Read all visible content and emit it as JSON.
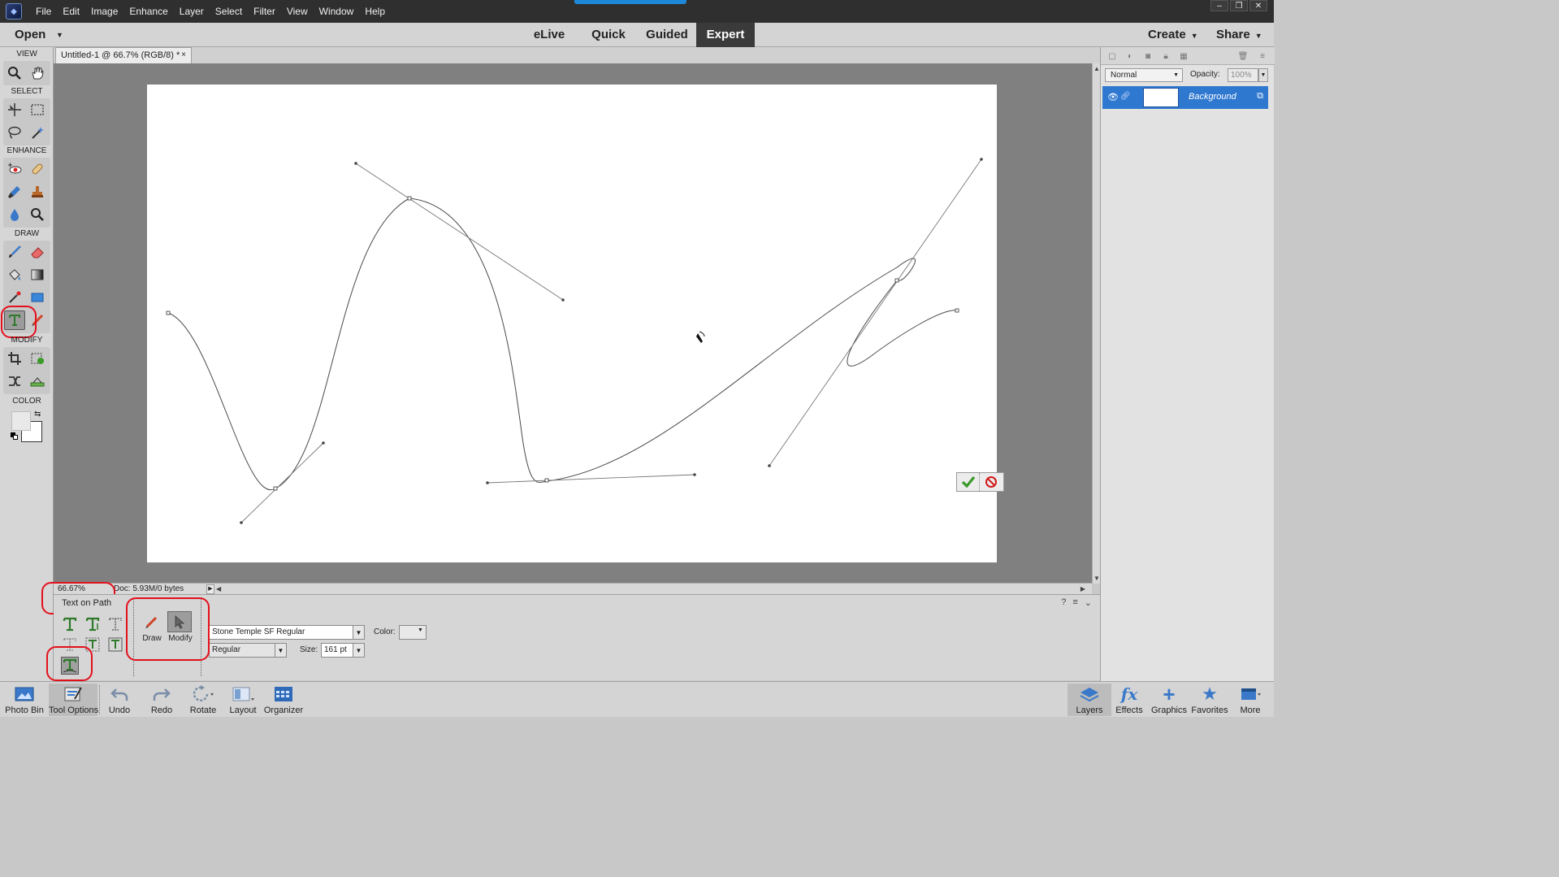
{
  "menubar": {
    "items": [
      "File",
      "Edit",
      "Image",
      "Enhance",
      "Layer",
      "Select",
      "Filter",
      "View",
      "Window",
      "Help"
    ],
    "window_controls": [
      "–",
      "❐",
      "✕"
    ]
  },
  "modebar": {
    "open": "Open",
    "tabs": [
      "eLive",
      "Quick",
      "Guided",
      "Expert"
    ],
    "active_tab": "Expert",
    "create": "Create",
    "share": "Share"
  },
  "toolbox": {
    "sections": [
      "VIEW",
      "SELECT",
      "ENHANCE",
      "DRAW",
      "MODIFY",
      "COLOR"
    ]
  },
  "document": {
    "tab_title": "Untitled-1 @ 66.7% (RGB/8) *",
    "close": "×"
  },
  "status": {
    "zoom": "66.67%",
    "doc_size": "Doc: 5.93M/0 bytes"
  },
  "tool_options": {
    "tool_name": "Text on Path",
    "draw_label": "Draw",
    "modify_label": "Modify",
    "font_family": "Stone Temple SF Regular",
    "font_style": "Regular",
    "color_label": "Color:",
    "size_label": "Size:",
    "size_value": "161 pt"
  },
  "layers_panel": {
    "blend_mode": "Normal",
    "opacity_label": "Opacity:",
    "opacity_value": "100%",
    "layer_name": "Background"
  },
  "bottom_bar": {
    "left": [
      "Photo Bin",
      "Tool Options",
      "Undo",
      "Redo",
      "Rotate",
      "Layout",
      "Organizer"
    ],
    "right": [
      "Layers",
      "Effects",
      "Graphics",
      "Favorites",
      "More"
    ]
  },
  "colors": {
    "accent_blue": "#2f78d0",
    "highlight_ring": "#e3101b",
    "commit_green": "#3a9a2a",
    "cancel_red": "#d21a1a"
  }
}
